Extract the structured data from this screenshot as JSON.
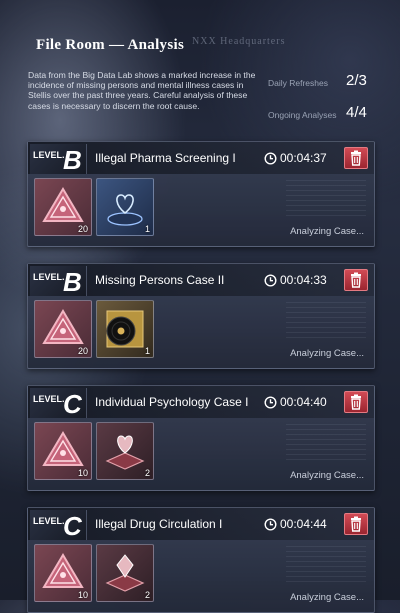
{
  "header": {
    "title": "File Room — Analysis",
    "hq_watermark": "NXX Headquarters",
    "description": "Data from the Big Data Lab shows a marked increase in the incidence of missing persons and mental illness cases in Stellis over the past three years. Careful analysis of these cases is necessary to discern the root cause.",
    "daily_refreshes_label": "Daily Refreshes",
    "daily_refreshes_value": "2/3",
    "ongoing_analyses_label": "Ongoing Analyses",
    "ongoing_analyses_value": "4/4"
  },
  "cases": [
    {
      "level_word": "LEVEL.",
      "level_letter": "B",
      "name": "Illegal Pharma Screening I",
      "timer": "00:04:37",
      "status": "Analyzing Case...",
      "items": [
        {
          "icon": "pink-triangle-token-icon",
          "qty": "20"
        },
        {
          "icon": "holographic-heart-device-icon",
          "qty": "1"
        }
      ]
    },
    {
      "level_word": "LEVEL.",
      "level_letter": "B",
      "name": "Missing Persons Case II",
      "timer": "00:04:33",
      "status": "Analyzing Case...",
      "items": [
        {
          "icon": "pink-triangle-token-icon",
          "qty": "20"
        },
        {
          "icon": "vinyl-record-icon",
          "qty": "1"
        }
      ]
    },
    {
      "level_word": "LEVEL.",
      "level_letter": "C",
      "name": "Individual Psychology Case I",
      "timer": "00:04:40",
      "status": "Analyzing Case...",
      "items": [
        {
          "icon": "pink-triangle-token-icon",
          "qty": "10"
        },
        {
          "icon": "red-heart-device-icon",
          "qty": "2"
        }
      ]
    },
    {
      "level_word": "LEVEL.",
      "level_letter": "C",
      "name": "Illegal Drug Circulation I",
      "timer": "00:04:44",
      "status": "Analyzing Case...",
      "items": [
        {
          "icon": "pink-triangle-token-icon",
          "qty": "10"
        },
        {
          "icon": "red-crystal-device-icon",
          "qty": "2"
        }
      ]
    }
  ]
}
